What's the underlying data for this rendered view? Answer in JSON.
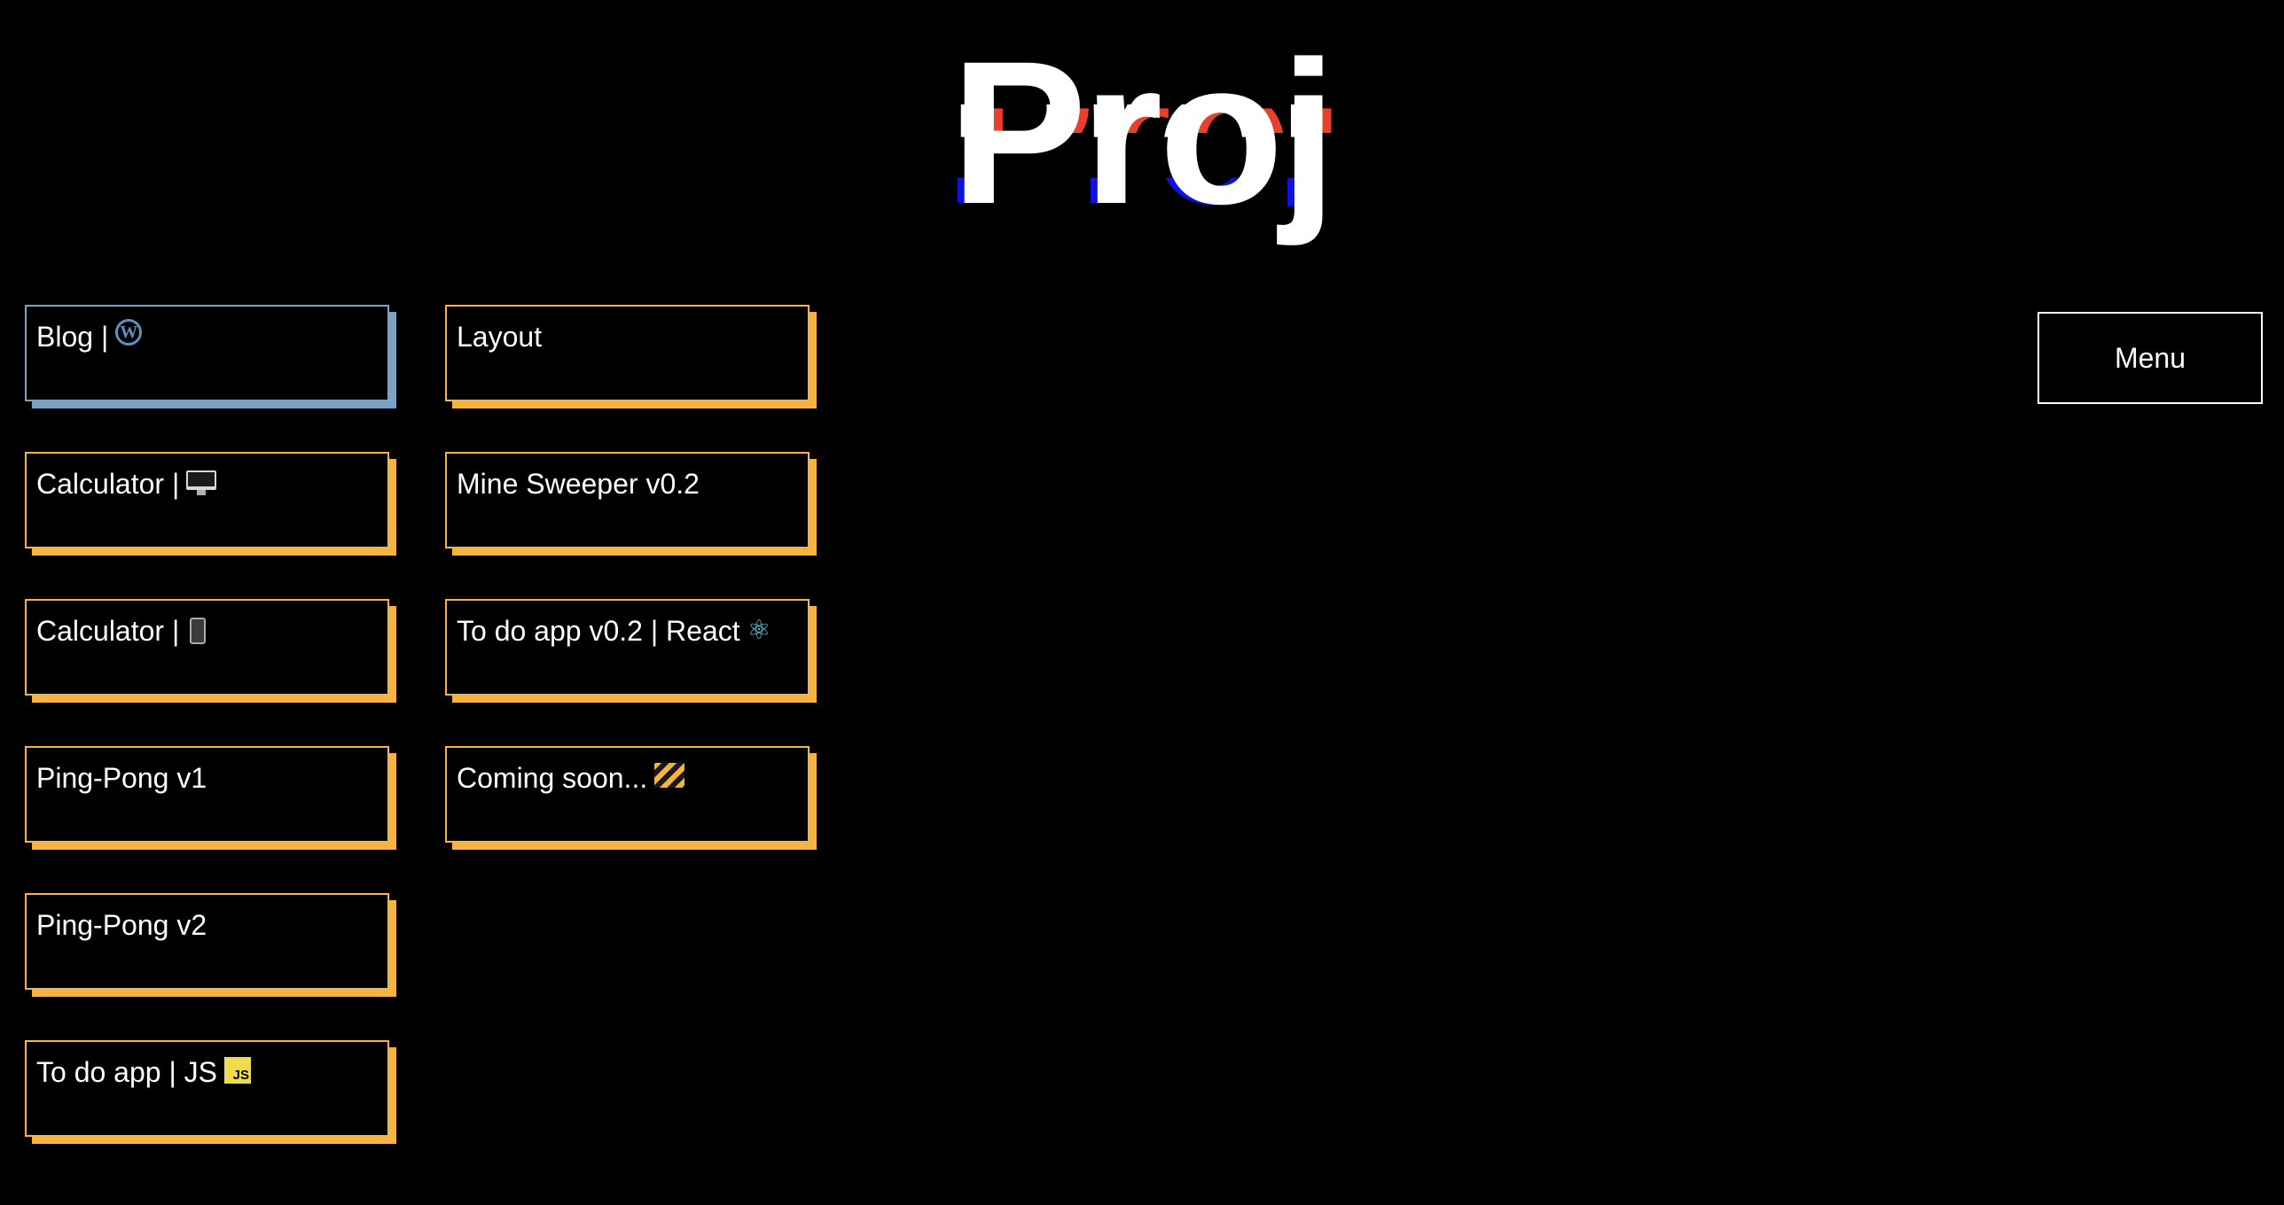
{
  "header": {
    "title": "Proj"
  },
  "menu": {
    "label": "Menu"
  },
  "projects": [
    {
      "label": "Blog |",
      "icon": "wordpress-icon"
    },
    {
      "label": "Layout",
      "icon": ""
    },
    {
      "label": "Calculator |",
      "icon": "desktop-icon"
    },
    {
      "label": "Mine Sweeper v0.2",
      "icon": ""
    },
    {
      "label": "Calculator |",
      "icon": "mobile-phone-icon"
    },
    {
      "label": "To do app v0.2 | React",
      "icon": "react-icon"
    },
    {
      "label": "Ping-Pong v1",
      "icon": ""
    },
    {
      "label": "Coming soon...",
      "icon": "construction-icon"
    },
    {
      "label": "Ping-Pong v2",
      "icon": ""
    },
    {
      "label": "To do app | JS",
      "icon": "javascript-icon"
    }
  ],
  "icons": {
    "wordpress": "W",
    "react": "⚛",
    "javascript": "JS"
  },
  "colors": {
    "background": "#000000",
    "card_accent": "#f5b342",
    "card_active_accent": "#7aa2c4",
    "text": "#ffffff",
    "glitch_red": "#e8402f",
    "glitch_blue": "#1010e0"
  }
}
